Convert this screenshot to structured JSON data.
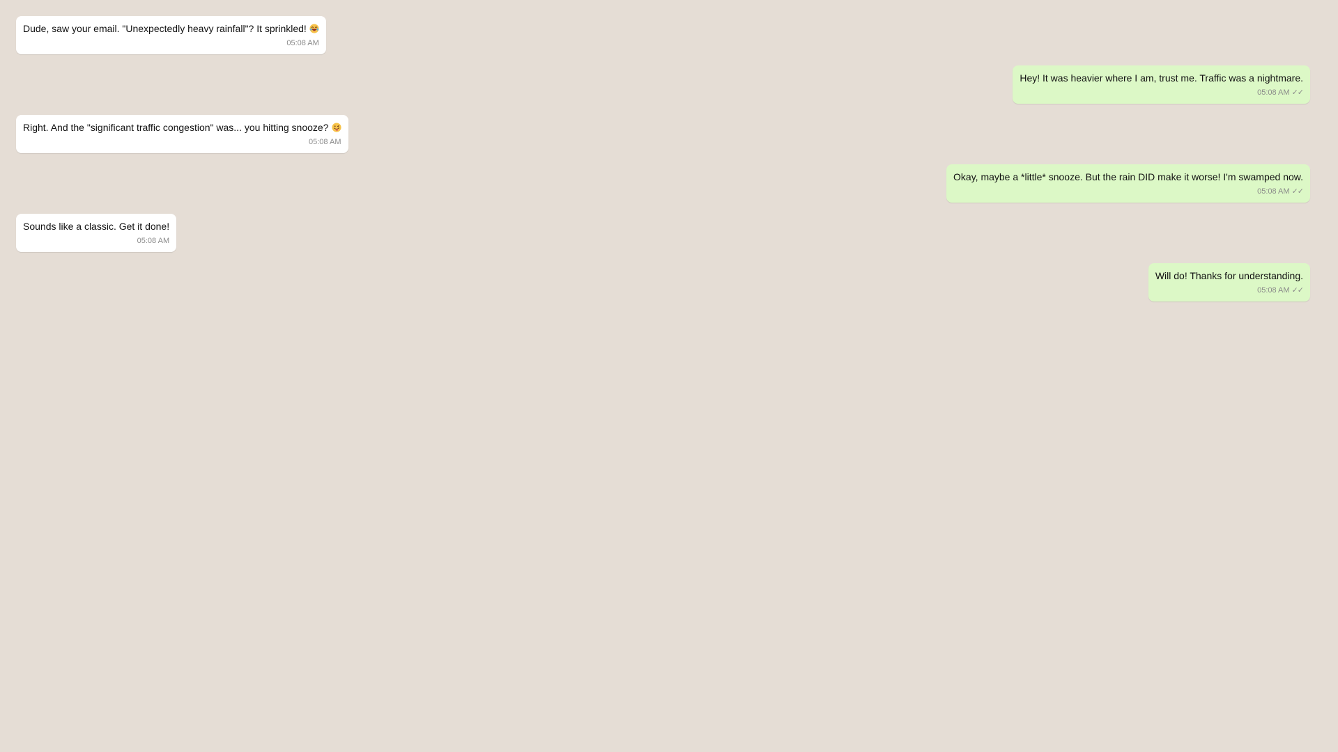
{
  "messages": [
    {
      "direction": "incoming",
      "text": "Dude, saw your email. \"Unexpectedly heavy rainfall\"? It sprinkled!",
      "emoji": "laughing-face-emoji",
      "time": "05:08 AM"
    },
    {
      "direction": "outgoing",
      "text": "Hey! It was heavier where I am, trust me. Traffic was a nightmare.",
      "time": "05:08 AM",
      "status_icon": "double-check-icon",
      "status_glyph": "✓✓"
    },
    {
      "direction": "incoming",
      "text": "Right. And the \"significant traffic congestion\" was... you hitting snooze?",
      "emoji": "winking-tongue-face-emoji",
      "time": "05:08 AM"
    },
    {
      "direction": "outgoing",
      "text": "Okay, maybe a *little* snooze. But the rain DID make it worse! I'm swamped now.",
      "time": "05:08 AM",
      "status_icon": "double-check-icon",
      "status_glyph": "✓✓"
    },
    {
      "direction": "incoming",
      "text": "Sounds like a classic. Get it done!",
      "time": "05:08 AM"
    },
    {
      "direction": "outgoing",
      "text": "Will do! Thanks for understanding.",
      "time": "05:08 AM",
      "status_icon": "double-check-icon",
      "status_glyph": "✓✓"
    }
  ],
  "colors": {
    "background": "#e5ddd5",
    "incoming_bubble": "#ffffff",
    "outgoing_bubble": "#dcf8c6",
    "meta_text": "#8a8a8a"
  }
}
